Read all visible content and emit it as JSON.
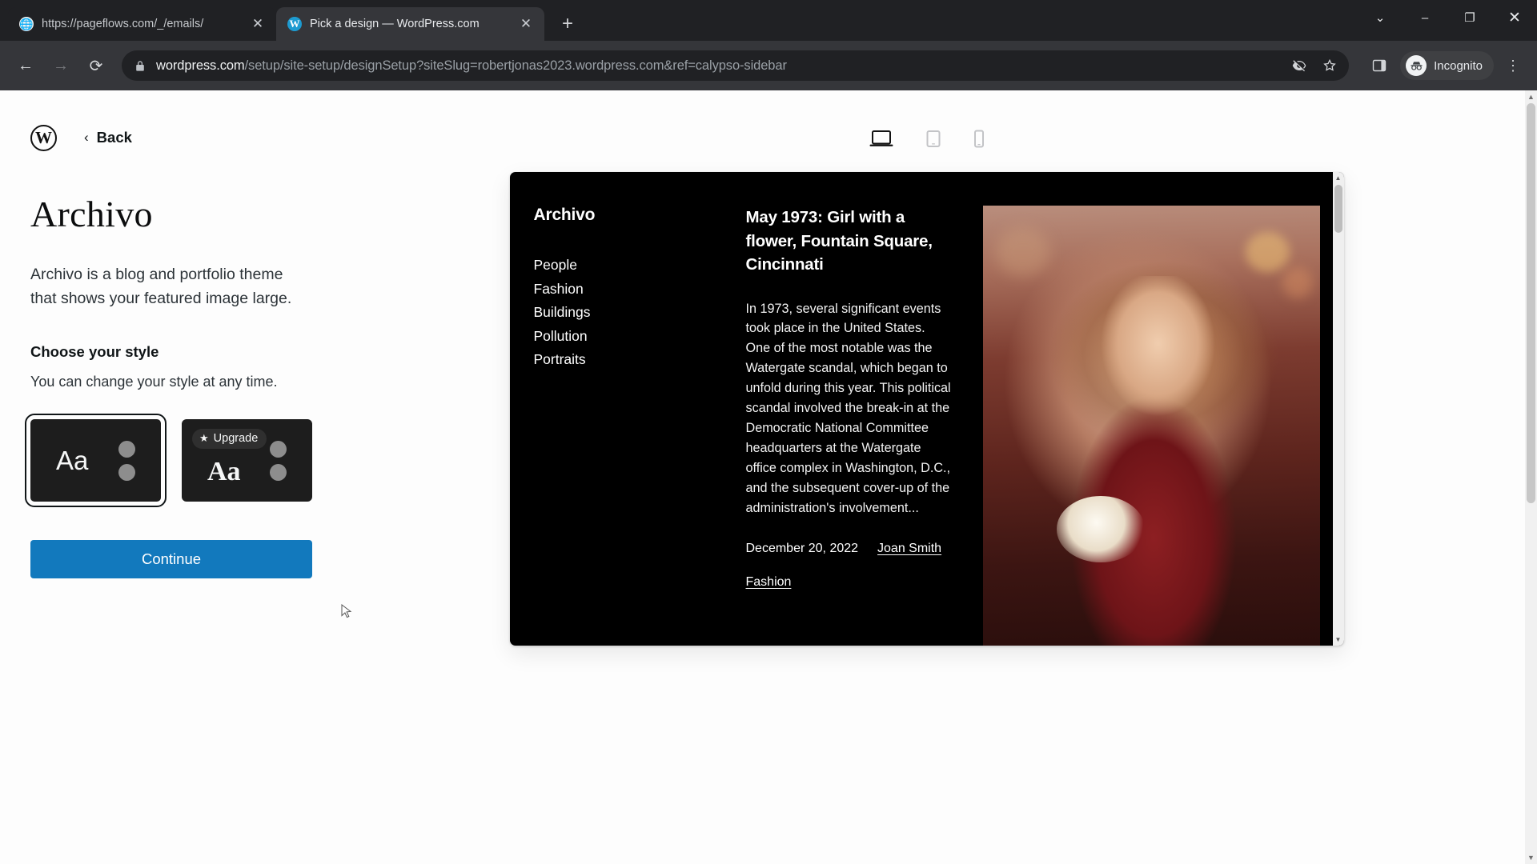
{
  "browser": {
    "tabs": [
      {
        "title": "https://pageflows.com/_/emails/",
        "favicon": "globe-icon",
        "active": false
      },
      {
        "title": "Pick a design — WordPress.com",
        "favicon": "wordpress-icon",
        "active": true
      }
    ],
    "new_tab_label": "+",
    "window_controls": {
      "minimize_menu": "⌄",
      "minimize": "–",
      "maximize": "❐",
      "close": "✕"
    },
    "nav": {
      "back": "←",
      "forward": "→",
      "reload": "⟳"
    },
    "omnibox": {
      "host": "wordpress.com",
      "path": "/setup/site-setup/designSetup?siteSlug=robertjonas2023.wordpress.com&ref=calypso-sidebar",
      "lock_icon": "lock-icon",
      "third_party_cookie_icon": "eye-slash-icon",
      "bookmark_icon": "star-icon"
    },
    "side_panel_icon": "side-panel-icon",
    "profile": {
      "label": "Incognito",
      "avatar_icon": "incognito-icon"
    },
    "menu_icon": "kebab-menu-icon"
  },
  "left": {
    "logo_letter": "W",
    "back_label": "Back",
    "back_chevron": "‹",
    "theme_title": "Archivo",
    "theme_description": "Archivo is a blog and portfolio theme that shows your featured image large.",
    "style_section_title": "Choose your style",
    "style_section_subtitle": "You can change your style at any time.",
    "styles": [
      {
        "sample_text": "Aa",
        "selected": true,
        "upgrade": false
      },
      {
        "sample_text": "Aa",
        "selected": false,
        "upgrade": true,
        "upgrade_label": "Upgrade",
        "star": "★"
      }
    ],
    "continue_label": "Continue",
    "accent_color": "#1279bd"
  },
  "preview": {
    "device_toggles": [
      {
        "name": "desktop",
        "active": true
      },
      {
        "name": "tablet",
        "active": false
      },
      {
        "name": "mobile",
        "active": false
      }
    ],
    "site": {
      "brand": "Archivo",
      "menu": [
        "People",
        "Fashion",
        "Buildings",
        "Pollution",
        "Portraits"
      ],
      "post": {
        "title": "May 1973: Girl with a flower, Fountain Square, Cincinnati",
        "body": "In 1973, several significant events took place in the United States. One of the most notable was the Watergate scandal, which began to unfold during this year. This political scandal involved the break-in at the Democratic National Committee headquarters at the Watergate office complex in Washington, D.C., and the subsequent cover-up of the administration's involvement...",
        "date": "December 20, 2022",
        "author": "Joan Smith",
        "category": "Fashion"
      }
    }
  }
}
